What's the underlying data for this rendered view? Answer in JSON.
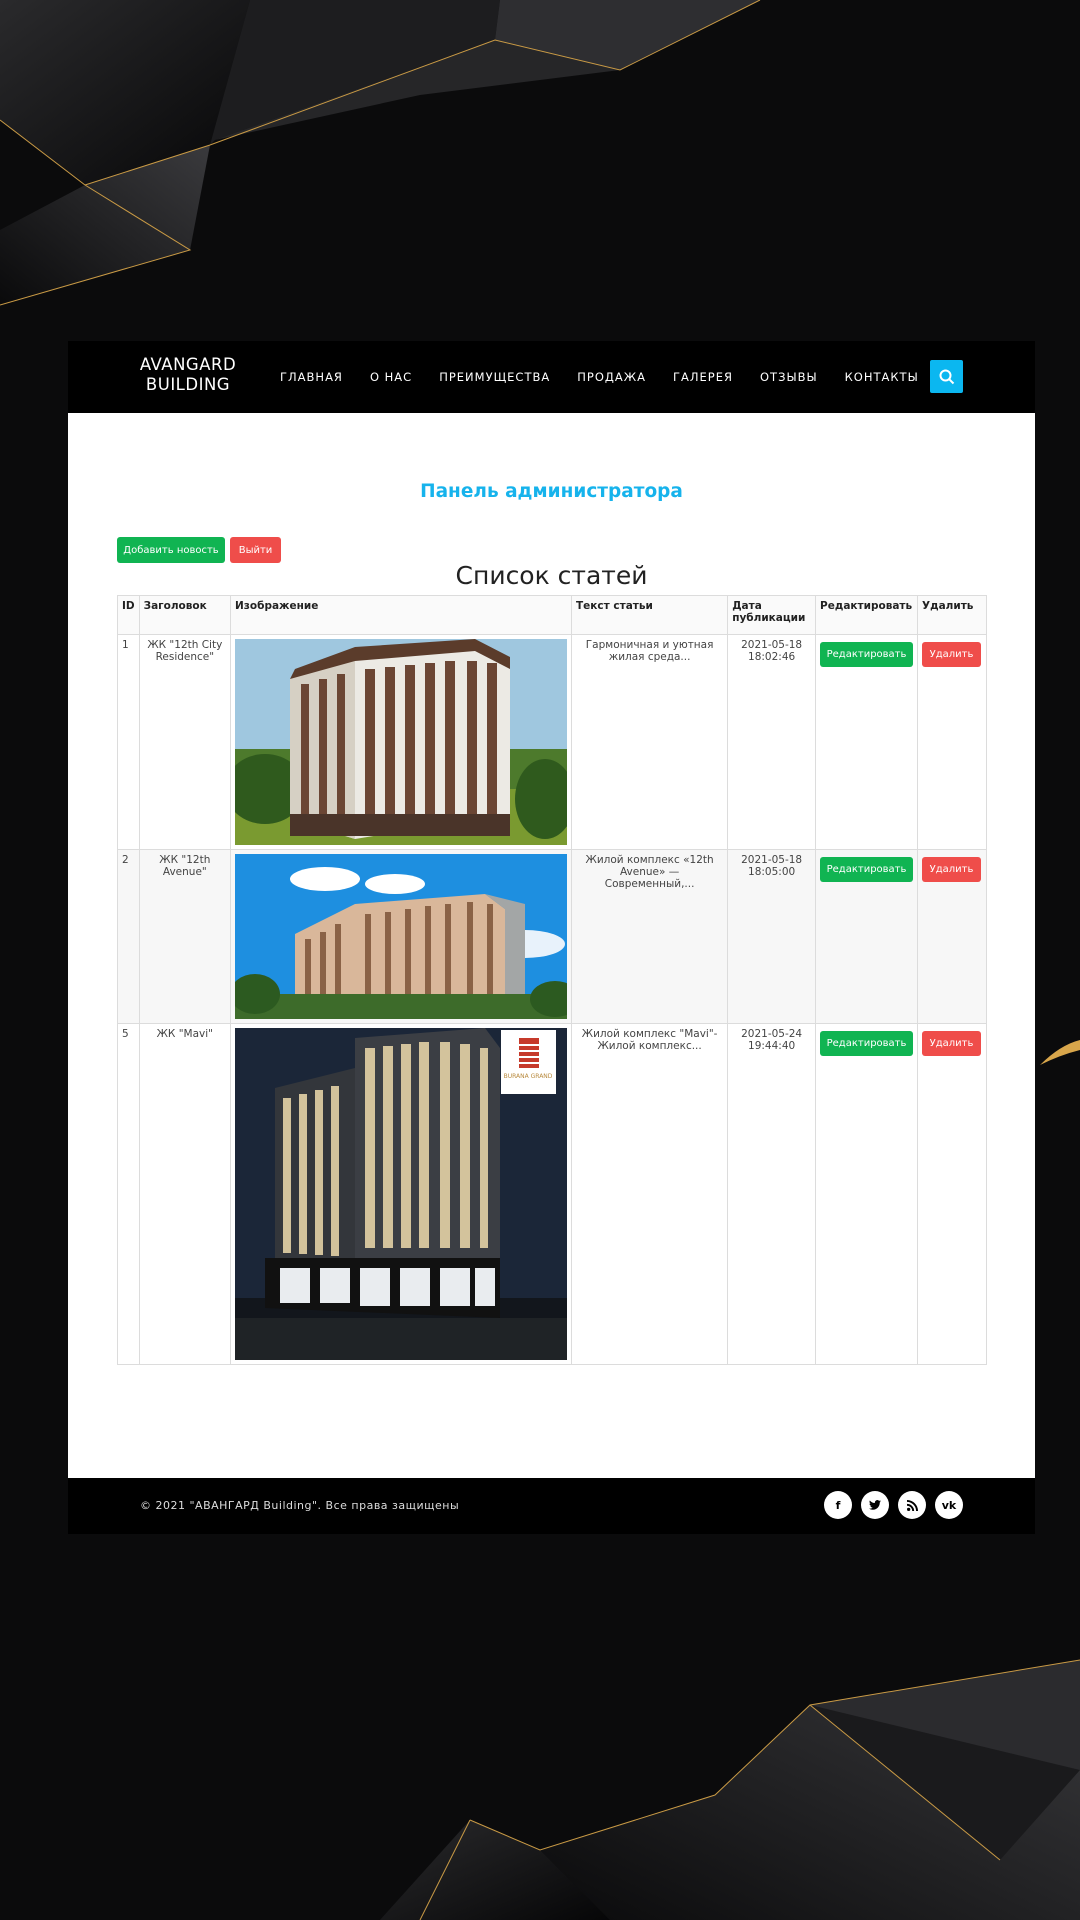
{
  "brand": {
    "line1": "AVANGARD",
    "line2": "BUILDING"
  },
  "nav": [
    {
      "label": "ГЛАВНАЯ"
    },
    {
      "label": "О НАС"
    },
    {
      "label": "ПРЕИМУЩЕСТВА"
    },
    {
      "label": "ПРОДАЖА"
    },
    {
      "label": "ГАЛЕРЕЯ"
    },
    {
      "label": "ОТЗЫВЫ"
    },
    {
      "label": "КОНТАКТЫ"
    }
  ],
  "admin": {
    "title": "Панель администратора",
    "add_label": "Добавить новость",
    "logout_label": "Выйти",
    "list_title": "Список статей"
  },
  "table": {
    "headers": [
      "ID",
      "Заголовок",
      "Изображение",
      "Текст статьи",
      "Дата публикации",
      "Редактировать",
      "Удалить"
    ],
    "rows": [
      {
        "id": "1",
        "title": "ЖК \"12th City Residence\"",
        "text": "Гармоничная и уютная жилая среда...",
        "date": "2021-05-18 18:02:46",
        "edit": "Редактировать",
        "delete": "Удалить"
      },
      {
        "id": "2",
        "title": "ЖК \"12th Avenue\"",
        "text": "Жилой комплекс «12th Avenue» — Современный,...",
        "date": "2021-05-18 18:05:00",
        "edit": "Редактировать",
        "delete": "Удалить"
      },
      {
        "id": "5",
        "title": "ЖК \"Mavi\"",
        "text": "Жилой комплекс \"Mavi\"- Жилой комплекс...",
        "date": "2021-05-24 19:44:40",
        "edit": "Редактировать",
        "delete": "Удалить",
        "logo_text": "BURANA GRAND"
      }
    ]
  },
  "footer": {
    "copyright": "© 2021 \"АВАНГАРД Building\". Все права защищены",
    "social": [
      {
        "icon": "facebook-icon",
        "glyph": "f"
      },
      {
        "icon": "twitter-icon",
        "glyph": "t"
      },
      {
        "icon": "rss-icon",
        "glyph": ""
      },
      {
        "icon": "vk-icon",
        "glyph": "vk"
      }
    ]
  },
  "colors": {
    "accent": "#16b3ec",
    "green": "#10b452",
    "red": "#ef4d4a",
    "search": "#0bb7f0"
  }
}
